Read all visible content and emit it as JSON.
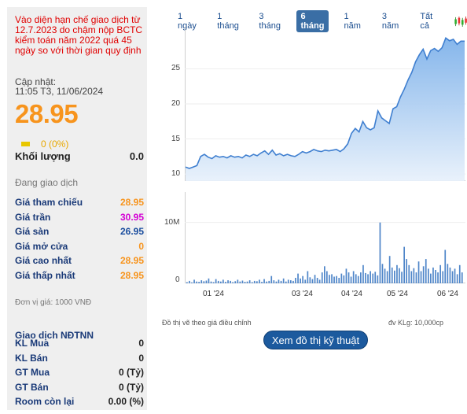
{
  "stock": {
    "notice": "Vào diện hạn chế giao dịch từ 12.7.2023 do chậm nộp BCTC kiểm toán năm 2022 quá 45 ngày so với thời gian quy định",
    "updated_label": "Cập nhật:",
    "updated_value": "11:05 T3, 11/06/2024",
    "price": "28.95",
    "change": "0 (0%)",
    "volume_label": "Khối lượng",
    "volume_value": "0.0",
    "status": "Đang giao dịch",
    "prices": [
      {
        "label": "Giá tham chiếu",
        "value": "28.95",
        "color": "#f7941d"
      },
      {
        "label": "Giá trần",
        "value": "30.95",
        "color": "#d400d4"
      },
      {
        "label": "Giá sàn",
        "value": "26.95",
        "color": "#1a4d9e"
      },
      {
        "label": "Giá mở cửa",
        "value": "0",
        "color": "#f7941d"
      },
      {
        "label": "Giá cao nhất",
        "value": "28.95",
        "color": "#f7941d"
      },
      {
        "label": "Giá thấp nhất",
        "value": "28.95",
        "color": "#f7941d"
      }
    ],
    "unit_note": "Đơn vị giá: 1000 VNĐ",
    "foreign_title": "Giao dịch NĐTNN",
    "foreign": [
      {
        "label": "KL Mua",
        "value": "0"
      },
      {
        "label": "KL Bán",
        "value": "0"
      },
      {
        "label": "GT Mua",
        "value": "0 (Tỷ)"
      },
      {
        "label": "GT Bán",
        "value": "0 (Tỷ)"
      },
      {
        "label": "Room còn lại",
        "value": "0.00 (%)"
      }
    ]
  },
  "periods": [
    "1 ngày",
    "1 tháng",
    "3 tháng",
    "6 tháng",
    "1 năm",
    "3 năm",
    "Tất cả"
  ],
  "active_period": "6 tháng",
  "icons": {
    "candle": "candlestick-chart-icon"
  },
  "chart_note_left": "Đồ thị vẽ theo giá điều chỉnh",
  "chart_note_right": "đv KLg: 10,000cp",
  "tech_button": "Xem đồ thị kỹ thuật",
  "colors": {
    "accent": "#f7941d",
    "brand": "#1c5a9e",
    "line": "#3f7fd0"
  },
  "chart_data": [
    {
      "type": "area",
      "x_ticks": [
        "01 '24",
        "03 '24",
        "04 '24",
        "05 '24",
        "06 '24"
      ],
      "y_ticks": [
        "10",
        "15",
        "20",
        "25"
      ],
      "ylim": [
        9,
        31
      ],
      "series": [
        {
          "values": [
            11.0,
            10.8,
            11.0,
            11.2,
            12.5,
            12.8,
            12.4,
            12.2,
            12.6,
            12.4,
            12.5,
            12.3,
            12.6,
            12.4,
            12.5,
            12.3,
            12.7,
            12.5,
            12.8,
            12.6,
            13.0,
            13.3,
            12.8,
            13.4,
            12.7,
            12.9,
            12.6,
            12.8,
            12.6,
            12.5,
            12.8,
            13.2,
            13.0,
            13.2,
            13.5,
            13.3,
            13.2,
            13.4,
            13.3,
            13.4,
            13.5,
            13.2,
            13.6,
            14.3,
            15.8,
            16.5,
            16.0,
            17.5,
            16.6,
            16.3,
            16.6,
            19.0,
            18.0,
            17.6,
            17.2,
            19.3,
            19.6,
            21.0,
            22.1,
            23.4,
            24.5,
            26.0,
            27.0,
            27.8,
            26.4,
            27.6,
            27.9,
            27.5,
            28.0,
            29.4,
            29.0,
            29.2,
            28.5,
            28.95,
            28.95
          ]
        }
      ]
    },
    {
      "type": "bar",
      "y_ticks": [
        "0",
        "10M"
      ],
      "ylim": [
        0,
        1500
      ],
      "series": [
        {
          "values": [
            20,
            40,
            15,
            60,
            30,
            25,
            50,
            35,
            45,
            80,
            30,
            20,
            70,
            40,
            30,
            60,
            25,
            50,
            40,
            20,
            35,
            60,
            30,
            45,
            25,
            30,
            50,
            20,
            40,
            35,
            60,
            25,
            70,
            30,
            40,
            120,
            50,
            30,
            60,
            40,
            80,
            30,
            60,
            50,
            40,
            90,
            160,
            80,
            120,
            60,
            200,
            100,
            70,
            140,
            90,
            60,
            180,
            280,
            200,
            140,
            150,
            110,
            120,
            90,
            160,
            130,
            240,
            180,
            110,
            200,
            150,
            120,
            180,
            300,
            170,
            150,
            200,
            160,
            190,
            130,
            1000,
            320,
            240,
            200,
            450,
            260,
            210,
            300,
            250,
            190,
            600,
            400,
            300,
            200,
            250,
            180,
            360,
            200,
            280,
            400,
            240,
            160,
            260,
            220,
            180,
            300,
            200,
            550,
            320,
            260,
            200,
            240,
            150,
            300,
            180
          ]
        }
      ]
    }
  ]
}
